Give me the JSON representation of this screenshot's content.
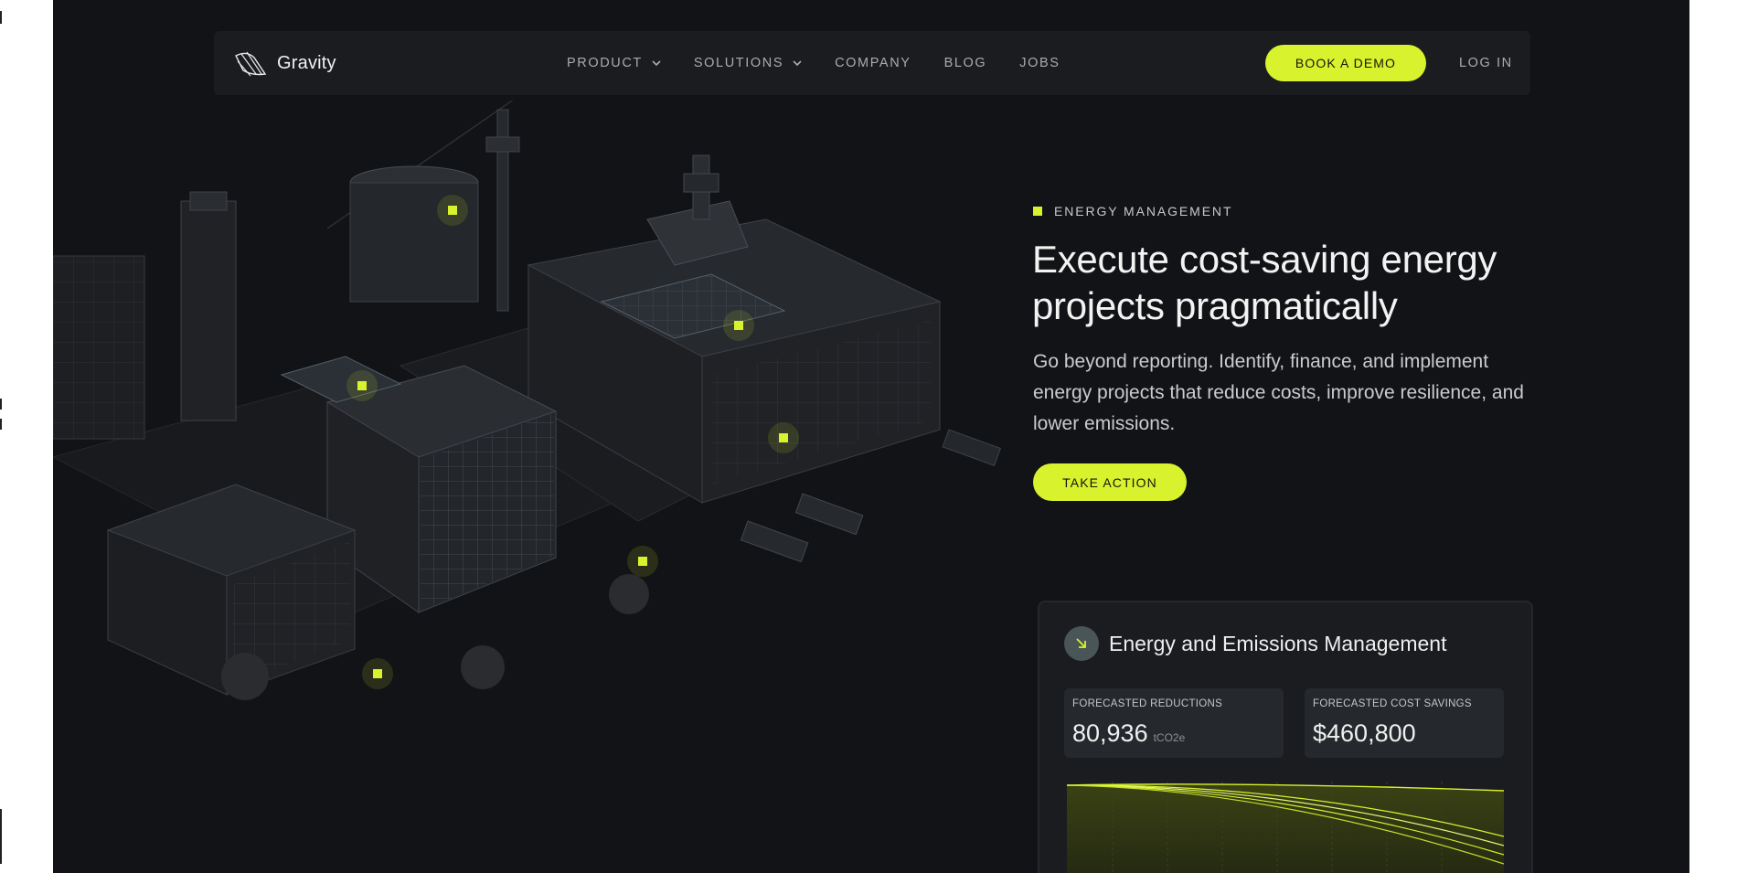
{
  "brand": {
    "name": "Gravity",
    "logo_icon": "gravity-logo-icon"
  },
  "nav": {
    "links": [
      {
        "label": "PRODUCT",
        "has_dropdown": true
      },
      {
        "label": "SOLUTIONS",
        "has_dropdown": true
      },
      {
        "label": "COMPANY",
        "has_dropdown": false
      },
      {
        "label": "BLOG",
        "has_dropdown": false
      },
      {
        "label": "JOBS",
        "has_dropdown": false
      }
    ],
    "cta_label": "BOOK A DEMO",
    "login_label": "LOG IN"
  },
  "hero": {
    "eyebrow": "ENERGY MANAGEMENT",
    "headline": "Execute cost-saving energy projects pragmatically",
    "subtext": "Go beyond reporting. Identify, finance, and implement energy projects that reduce costs, improve resilience, and lower emissions.",
    "cta_label": "TAKE ACTION"
  },
  "card": {
    "title": "Energy and Emissions Management",
    "icon": "arrow-down-right-icon",
    "stats": [
      {
        "label": "FORECASTED REDUCTIONS",
        "value": "80,936",
        "unit": "tCO2e"
      },
      {
        "label": "FORECASTED COST SAVINGS",
        "value": "$460,800",
        "unit": ""
      }
    ]
  },
  "chat_widget": {
    "icon": "chat-bubble-icon"
  },
  "colors": {
    "accent": "#d8f22e",
    "background": "#121316",
    "nav_background": "#1b1c20",
    "card_background": "#1a1c20",
    "text_primary": "#f3f3f3",
    "text_muted": "#a9abb0"
  }
}
